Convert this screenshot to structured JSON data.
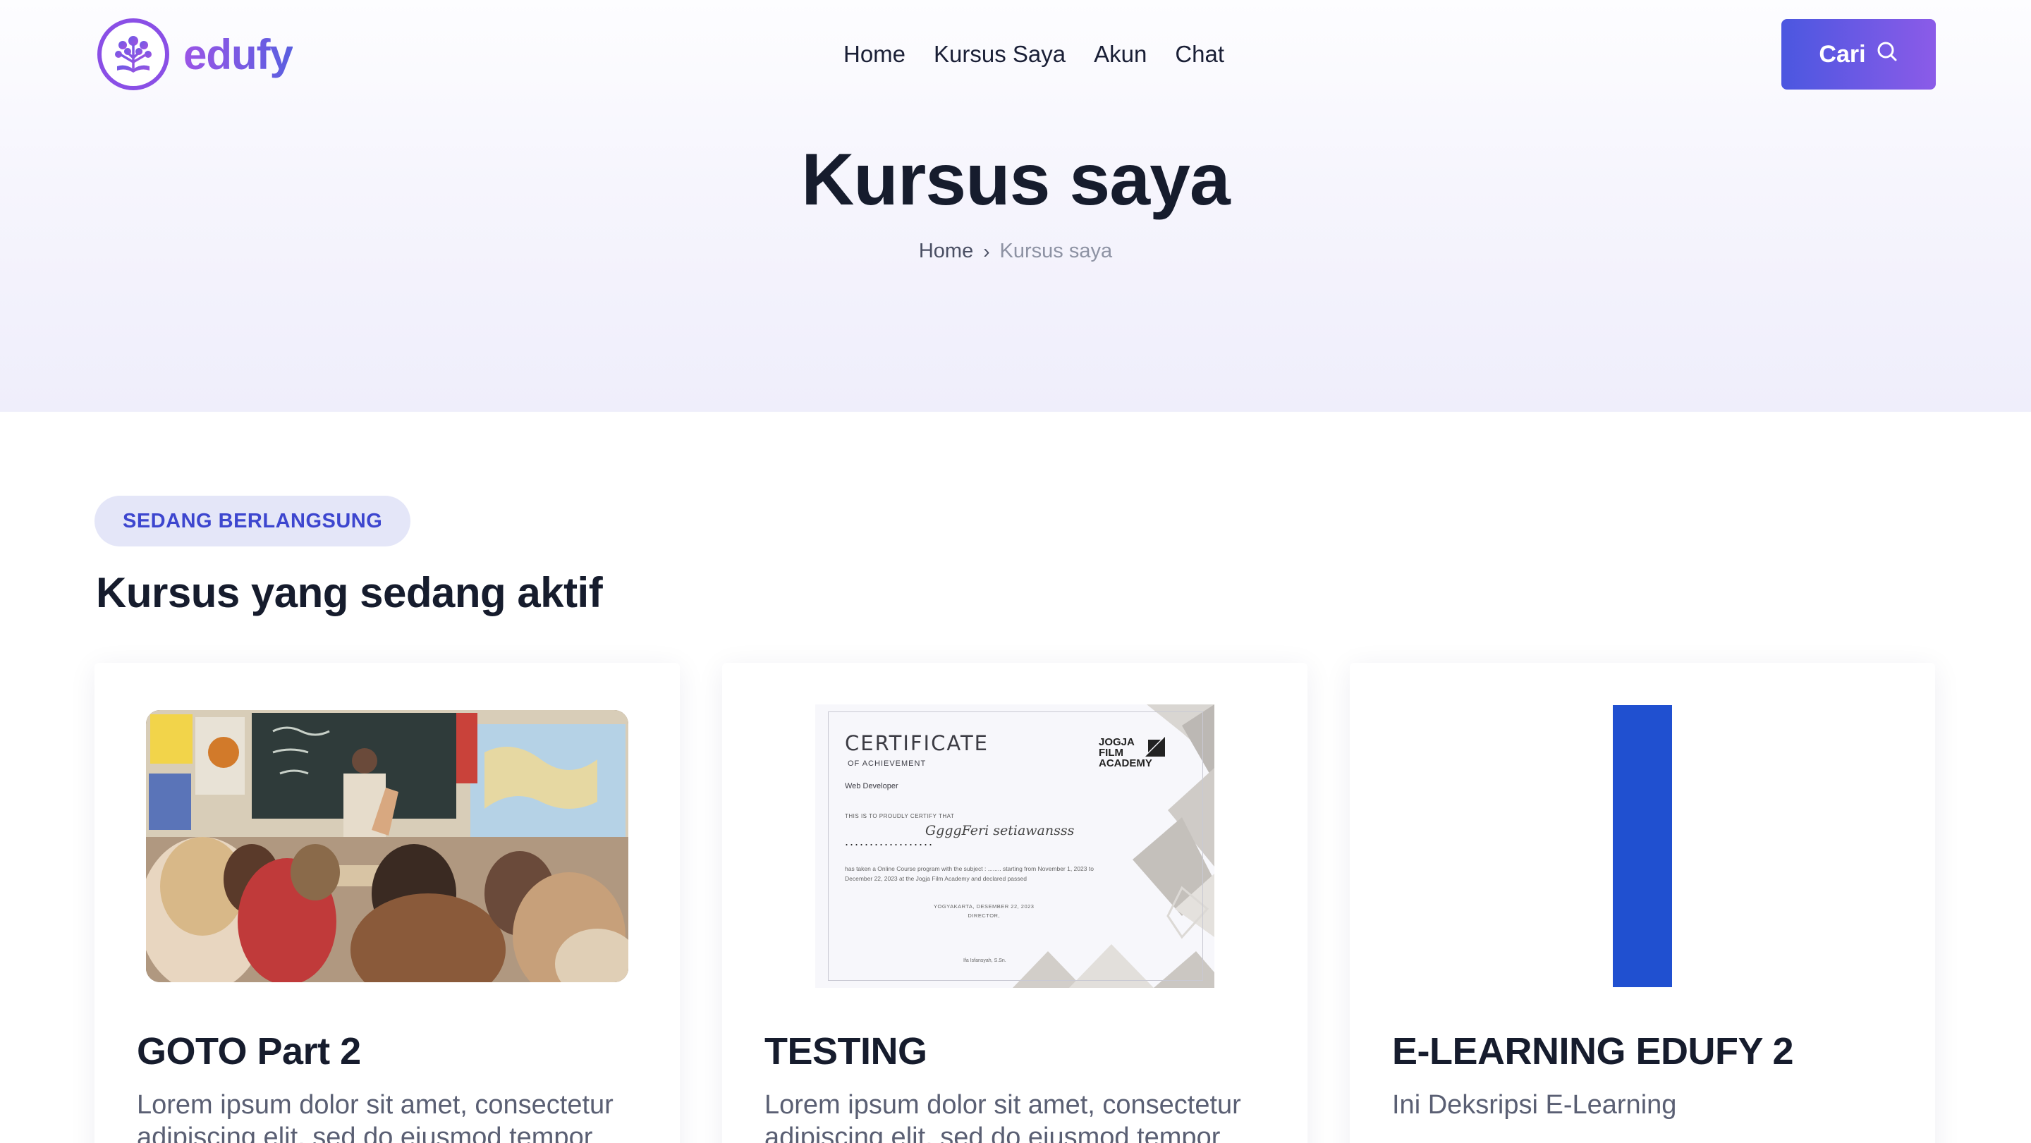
{
  "header": {
    "logo_text": "edufy",
    "nav": [
      "Home",
      "Kursus Saya",
      "Akun",
      "Chat"
    ],
    "search_label": "Cari"
  },
  "hero": {
    "title": "Kursus saya",
    "breadcrumb": {
      "home": "Home",
      "separator": "›",
      "current": "Kursus saya"
    }
  },
  "section": {
    "badge": "SEDANG BERLANGSUNG",
    "title": "Kursus yang sedang aktif"
  },
  "courses": [
    {
      "title": "GOTO Part 2",
      "description": "Lorem ipsum dolor sit amet, consectetur adipiscing elit, sed do eiusmod tempor",
      "image": "classroom-photo"
    },
    {
      "title": "TESTING",
      "description": "Lorem ipsum dolor sit amet, consectetur adipiscing elit, sed do eiusmod tempor",
      "image": "certificate-image",
      "certificate": {
        "title": "CERTIFICATE",
        "subtitle": "OF ACHIEVEMENT",
        "role": "Web Developer",
        "certify_text": "THIS IS TO PROUDLY CERTIFY THAT",
        "name": "GgggFeri setiawansss",
        "dots": "..................",
        "body": "has taken a Online Course program with the subject : ........ starting from November 1, 2023 to December 22, 2023 at the Jogja Film Academy and declared passed",
        "place": "YOGYAKARTA, DESEMBER 22, 2023",
        "director": "DIRECTOR,",
        "signatory": "Ifa Isfansyah, S.Sn.",
        "logo": "JOGJA FILM ACADEMY"
      }
    },
    {
      "title": "E-LEARNING EDUFY 2",
      "description": "Ini Deksripsi E-Learning",
      "image": "blue-bar-image"
    }
  ],
  "colors": {
    "brand_gradient_start": "#4b57e0",
    "brand_gradient_end": "#8b5be8",
    "badge_bg": "#e4e6f8",
    "badge_text": "#3d46cf",
    "title_text": "#161c2d",
    "blue_bar": "#2050d0"
  }
}
